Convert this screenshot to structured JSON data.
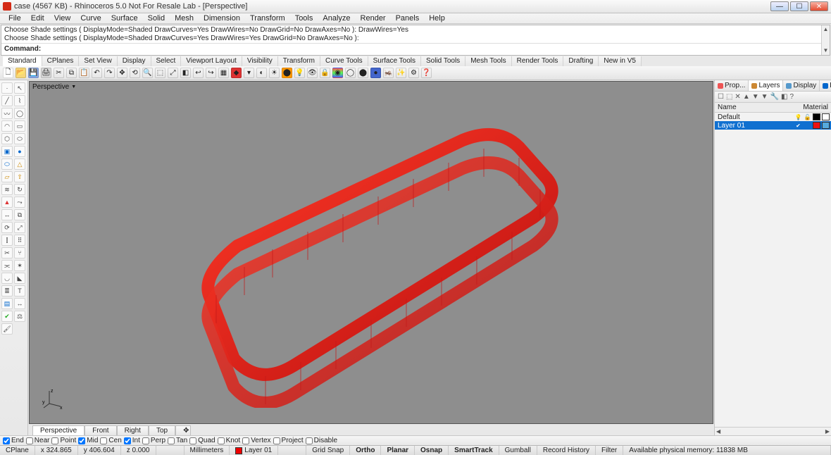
{
  "window": {
    "title": "case (4567 KB) - Rhinoceros 5.0 Not For Resale Lab - [Perspective]"
  },
  "menu": [
    "File",
    "Edit",
    "View",
    "Curve",
    "Surface",
    "Solid",
    "Mesh",
    "Dimension",
    "Transform",
    "Tools",
    "Analyze",
    "Render",
    "Panels",
    "Help"
  ],
  "command_history": [
    "Choose Shade settings ( DisplayMode=Shaded  DrawCurves=Yes  DrawWires=No  DrawGrid=No  DrawAxes=No ): DrawWires=Yes",
    "Choose Shade settings ( DisplayMode=Shaded  DrawCurves=Yes  DrawWires=Yes  DrawGrid=No  DrawAxes=No ):"
  ],
  "command_label": "Command:",
  "tool_tabs": [
    "Standard",
    "CPlanes",
    "Set View",
    "Display",
    "Select",
    "Viewport Layout",
    "Visibility",
    "Transform",
    "Curve Tools",
    "Surface Tools",
    "Solid Tools",
    "Mesh Tools",
    "Render Tools",
    "Drafting",
    "New in V5"
  ],
  "viewport": {
    "label": "Perspective"
  },
  "view_tabs": [
    "Perspective",
    "Front",
    "Right",
    "Top"
  ],
  "right_panel": {
    "tabs": [
      "Prop...",
      "Layers",
      "Display",
      "Help"
    ],
    "columns": {
      "name": "Name",
      "material": "Material"
    },
    "layers": [
      {
        "name": "Default",
        "visible": true,
        "locked": false,
        "color": "#000000",
        "selected": false
      },
      {
        "name": "Layer 01",
        "visible": true,
        "locked": false,
        "color": "#ee1111",
        "selected": true
      }
    ]
  },
  "osnaps": [
    {
      "label": "End",
      "checked": true
    },
    {
      "label": "Near",
      "checked": false
    },
    {
      "label": "Point",
      "checked": false
    },
    {
      "label": "Mid",
      "checked": true
    },
    {
      "label": "Cen",
      "checked": false
    },
    {
      "label": "Int",
      "checked": true
    },
    {
      "label": "Perp",
      "checked": false
    },
    {
      "label": "Tan",
      "checked": false
    },
    {
      "label": "Quad",
      "checked": false
    },
    {
      "label": "Knot",
      "checked": false
    },
    {
      "label": "Vertex",
      "checked": false
    },
    {
      "label": "Project",
      "checked": false
    },
    {
      "label": "Disable",
      "checked": false
    }
  ],
  "status": {
    "cplane": "CPlane",
    "x": "x 324.865",
    "y": "y 406.604",
    "z": "z 0.000",
    "units": "Millimeters",
    "layer": "Layer 01",
    "gridsnap": "Grid Snap",
    "ortho": "Ortho",
    "planar": "Planar",
    "osnap": "Osnap",
    "smarttrack": "SmartTrack",
    "gumball": "Gumball",
    "record": "Record History",
    "filter": "Filter",
    "memory": "Available physical memory: 11838 MB"
  }
}
